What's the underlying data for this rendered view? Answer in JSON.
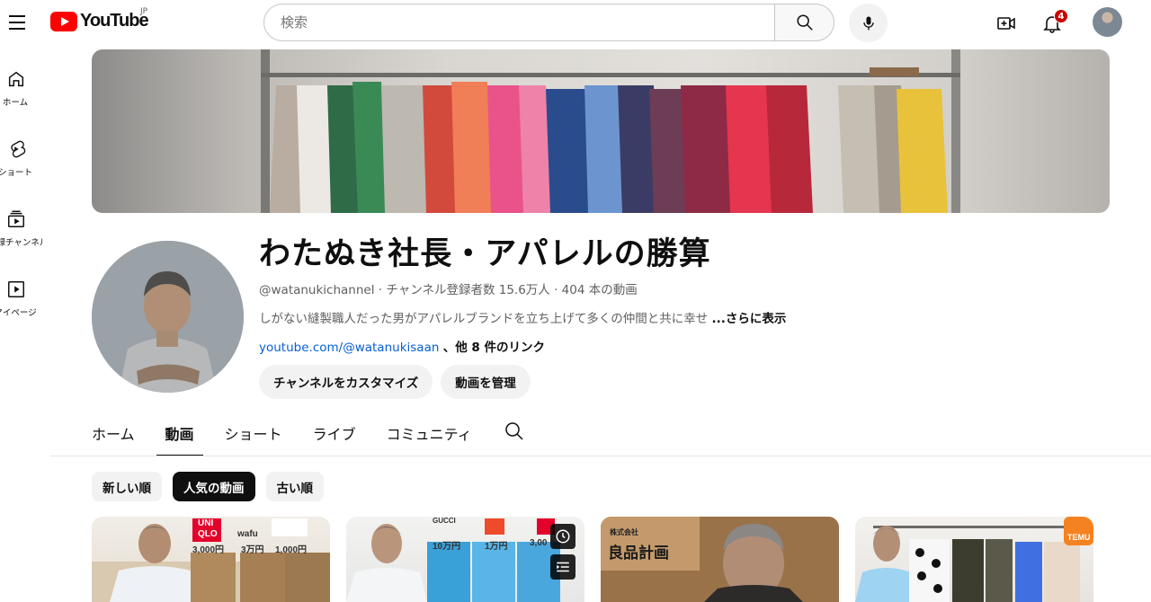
{
  "masthead": {
    "logo_text": "YouTube",
    "country_code": "JP",
    "search_placeholder": "検索",
    "notification_count": "4"
  },
  "guide": {
    "items": [
      {
        "label": "ホーム",
        "icon": "home-icon"
      },
      {
        "label": "ショート",
        "icon": "shorts-icon"
      },
      {
        "label": "登録チャンネル",
        "icon": "subscriptions-icon"
      },
      {
        "label": "マイページ",
        "icon": "you-icon"
      }
    ]
  },
  "channel": {
    "title": "わたぬき社長・アパレルの勝算",
    "meta": "@watanukichannel · チャンネル登録者数 15.6万人 · 404 本の動画",
    "description": "しがない縫製職人だった男がアパレルブランドを立ち上げて多くの仲間と共に幸せ",
    "more_label": "...さらに表示",
    "link_url": "youtube.com/@watanukisaan",
    "link_rest": "、他 8 件のリンク",
    "customize_button": "チャンネルをカスタマイズ",
    "manage_button": "動画を管理"
  },
  "tabs": [
    {
      "label": "ホーム",
      "active": false
    },
    {
      "label": "動画",
      "active": true
    },
    {
      "label": "ショート",
      "active": false
    },
    {
      "label": "ライブ",
      "active": false
    },
    {
      "label": "コミュニティ",
      "active": false
    }
  ],
  "sort_chips": [
    {
      "label": "新しい順",
      "selected": false
    },
    {
      "label": "人気の動画",
      "selected": true
    },
    {
      "label": "古い順",
      "selected": false
    }
  ],
  "videos": [
    {
      "overlay_texts": [
        "UNI",
        "QLO",
        "wafu",
        "3,000円",
        "3万円",
        "1,000円"
      ]
    },
    {
      "overlay_texts": [
        "GUCCI",
        "10万円",
        "1万円",
        "3,00"
      ]
    },
    {
      "overlay_texts": [
        "株式会社",
        "良品計画"
      ]
    },
    {
      "overlay_texts": [
        "TEMU"
      ]
    }
  ],
  "colors": {
    "brand_red": "#ff0000",
    "link_blue": "#065fd4",
    "badge_red": "#cc0000",
    "chip_selected": "#0f0f0f"
  }
}
